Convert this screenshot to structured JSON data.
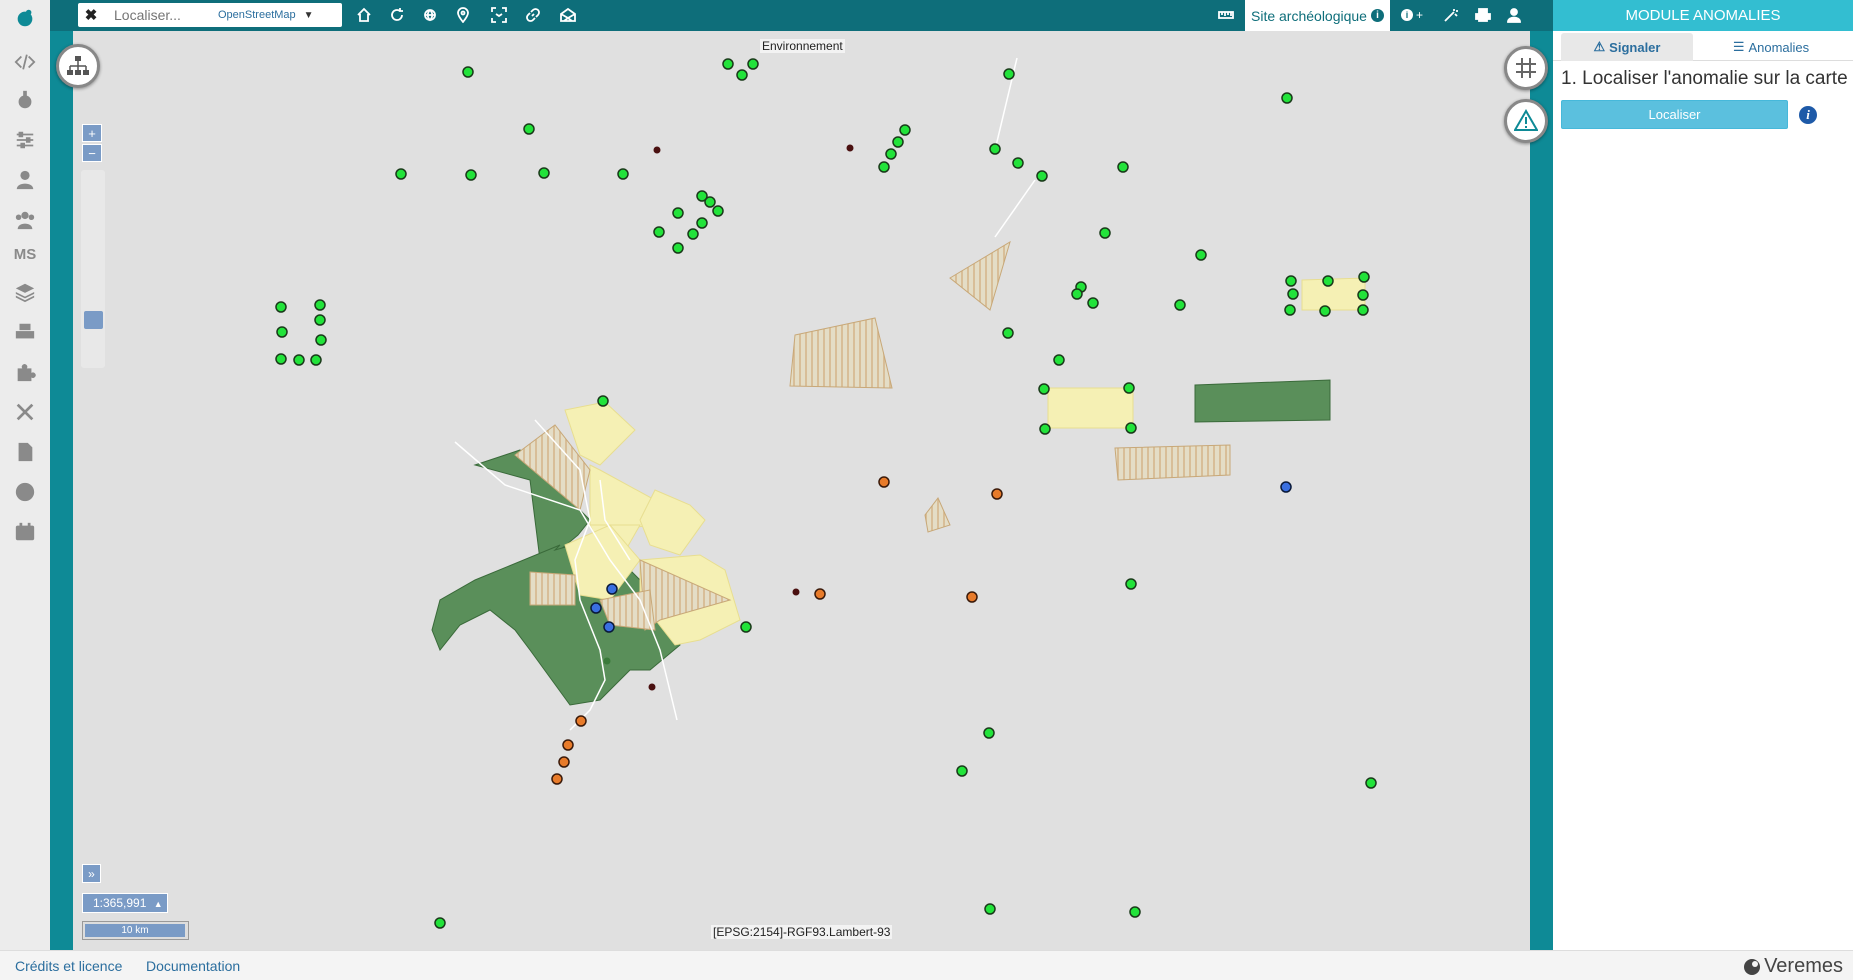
{
  "search": {
    "placeholder": "Localiser...",
    "source": "OpenStreetMap"
  },
  "toolbar": {
    "site_label": "Site archéologique",
    "info_plus": "+"
  },
  "panel": {
    "title": "MODULE ANOMALIES",
    "tab_signaler": "Signaler",
    "tab_anomalies": "Anomalies",
    "step_title": "1. Localiser l'anomalie sur la carte",
    "localiser_button": "Localiser"
  },
  "map": {
    "layer_label": "Environnement",
    "projection": "[EPSG:2154]-RGF93.Lambert-93",
    "scale": "1:365,991",
    "scale_bar": "10 km",
    "zoom_in": "+",
    "zoom_out": "−",
    "expand": "»",
    "zoom_level_fraction": 0.72
  },
  "rail": {
    "ms_label": "MS"
  },
  "footer": {
    "credits": "Crédits et licence",
    "documentation": "Documentation",
    "brand": "Veremes"
  },
  "colors": {
    "teal_frame": "#0e8a96",
    "topbar": "#0e6e7a",
    "panel_header": "#33bed1",
    "button": "#5bc0de",
    "map_bg": "#e0e0e0",
    "point_green": "#22e33a",
    "point_orange": "#e87b2a",
    "point_blue": "#3a6fe0",
    "point_dark": "#4a1010",
    "polygon_dark": "#5a8f5a",
    "polygon_yellow": "#f5f0b4"
  }
}
